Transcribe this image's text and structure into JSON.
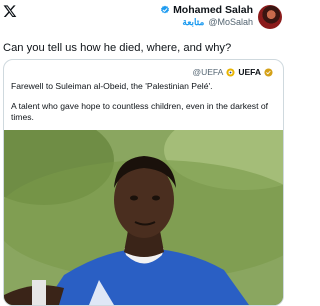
{
  "header": {
    "platform_icon": "x-logo-icon",
    "author_name": "Mohamed Salah",
    "author_handle": "@MoSalah",
    "follow_label": "متابعة",
    "verified_icon": "verified-badge-icon",
    "accent_color": "#1d9bf0"
  },
  "tweet": {
    "text": "Can you tell us how he died, where, and why?"
  },
  "quote": {
    "handle": "@UEFA",
    "name": "UEFA",
    "badge_icon": "uefa-logo-icon",
    "line1": "Farewell to Suleiman al-Obeid, the 'Palestinian Pelé'.",
    "line2": "A talent who gave hope to countless children, even in the darkest of times."
  },
  "photo": {
    "subject": "footballer-photo"
  }
}
